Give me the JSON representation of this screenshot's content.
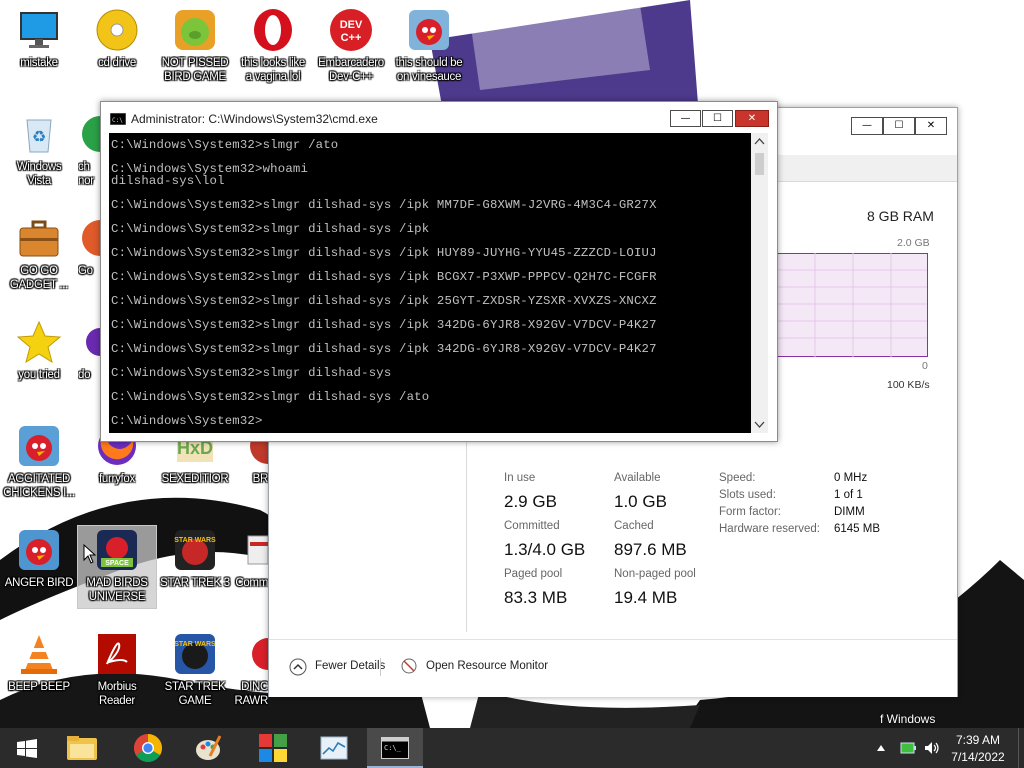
{
  "desktop": {
    "icons": [
      {
        "id": "mistake",
        "label": "mistake",
        "icon": "monitor-icon"
      },
      {
        "id": "cd-drive",
        "label": "cd drive",
        "icon": "cd-icon"
      },
      {
        "id": "not-pissed",
        "label": "NOT PISSED\nBIRD GAME",
        "icon": "green-pig-icon"
      },
      {
        "id": "opera",
        "label": "this looks like\na vagina lol",
        "icon": "opera-icon"
      },
      {
        "id": "devcpp",
        "label": "Embarcadero\nDev-C++",
        "icon": "devcpp-icon"
      },
      {
        "id": "vinesauce",
        "label": "this should be\non vinesauce",
        "icon": "angry-bird-icon"
      },
      {
        "id": "winvista",
        "label": "Windows\nVista",
        "icon": "recycle-bin-icon"
      },
      {
        "id": "go-gadget",
        "label": "GO GO\nGADGET ...",
        "icon": "briefcase-icon"
      },
      {
        "id": "you-tried",
        "label": "you tried",
        "icon": "star-icon"
      },
      {
        "id": "agitated",
        "label": "AGGITATED\nCHICKENS I...",
        "icon": "angry-bird-icon"
      },
      {
        "id": "furryfox",
        "label": "furryfox",
        "icon": "firefox-icon"
      },
      {
        "id": "sexeditor",
        "label": "SEXEDITIOR",
        "icon": "hex-editor-icon"
      },
      {
        "id": "anger-bird",
        "label": "ANGER BIRD",
        "icon": "angry-bird-icon"
      },
      {
        "id": "mad-birds",
        "label": "MAD BIRDS\nUNIVERSE",
        "icon": "angry-birds-space-icon"
      },
      {
        "id": "star-trek-3",
        "label": "STAR TREK 3",
        "icon": "star-wars-bird-icon"
      },
      {
        "id": "beep-beep",
        "label": "BEEP BEEP",
        "icon": "vlc-icon"
      },
      {
        "id": "morbius",
        "label": "Morbius\nReader",
        "icon": "pdf-icon"
      },
      {
        "id": "star-trek-game",
        "label": "STAR TREK\nGAME",
        "icon": "star-wars-bird-icon"
      }
    ],
    "partial_labels": {
      "col3_r2": "ch\nnor",
      "col3_r3": "Go",
      "col3_r4": "do",
      "col4_r5": "BR",
      "col4_r6": "Comm",
      "col4_r7": "DINC\nRAWR"
    },
    "watermark_fragment": "f Windows"
  },
  "cmd": {
    "title": "Administrator: C:\\Windows\\System32\\cmd.exe",
    "lines": [
      "C:\\Windows\\System32>slmgr /ato",
      "C:\\Windows\\System32>whoami",
      "dilshad-sys\\lol",
      "C:\\Windows\\System32>slmgr dilshad-sys /ipk MM7DF-G8XWM-J2VRG-4M3C4-GR27X",
      "C:\\Windows\\System32>slmgr dilshad-sys /ipk",
      "C:\\Windows\\System32>slmgr dilshad-sys /ipk HUY89-JUYHG-YYU45-ZZZCD-LOIUJ",
      "C:\\Windows\\System32>slmgr dilshad-sys /ipk BCGX7-P3XWP-PPPCV-Q2H7C-FCGFR",
      "C:\\Windows\\System32>slmgr dilshad-sys /ipk 25GYT-ZXDSR-YZSXR-XVXZS-XNCXZ",
      "C:\\Windows\\System32>slmgr dilshad-sys /ipk 342DG-6YJR8-X92GV-V7DCV-P4K27",
      "C:\\Windows\\System32>slmgr dilshad-sys /ipk 342DG-6YJR8-X92GV-V7DCV-P4K27",
      "C:\\Windows\\System32>slmgr dilshad-sys",
      "C:\\Windows\\System32>slmgr dilshad-sys /ato",
      "C:\\Windows\\System32>"
    ],
    "buttons": {
      "minimize": "—",
      "maximize": "☐",
      "close": "✕"
    }
  },
  "taskmgr": {
    "buttons": {
      "minimize": "—",
      "maximize": "☐",
      "close": "✕"
    },
    "ram_total": "8 GB RAM",
    "graph_max": "2.0 GB",
    "graph_min": "0",
    "speed_label": "100 KB/s",
    "stats": {
      "in_use_label": "In use",
      "in_use": "2.9 GB",
      "available_label": "Available",
      "available": "1.0 GB",
      "committed_label": "Committed",
      "committed": "1.3/4.0 GB",
      "cached_label": "Cached",
      "cached": "897.6 MB",
      "paged_label": "Paged pool",
      "paged": "83.3 MB",
      "nonpaged_label": "Non-paged pool",
      "nonpaged": "19.4 MB"
    },
    "details": [
      {
        "key": "Speed:",
        "value": "0 MHz"
      },
      {
        "key": "Slots used:",
        "value": "1 of 1"
      },
      {
        "key": "Form factor:",
        "value": "DIMM"
      },
      {
        "key": "Hardware reserved:",
        "value": "6145 MB"
      }
    ],
    "footer": {
      "fewer": "Fewer Details",
      "monitor": "Open Resource Monitor"
    }
  },
  "taskbar": {
    "items": [
      {
        "id": "start",
        "icon": "windows-start-icon"
      },
      {
        "id": "explorer",
        "icon": "folder-icon"
      },
      {
        "id": "chrome",
        "icon": "chrome-icon"
      },
      {
        "id": "paint",
        "icon": "paint-icon"
      },
      {
        "id": "winlogo",
        "icon": "windows-flag-icon"
      },
      {
        "id": "taskmgr",
        "icon": "task-manager-icon"
      },
      {
        "id": "cmd",
        "icon": "cmd-icon"
      }
    ],
    "time": "7:39 AM",
    "date": "7/14/2022"
  },
  "colors": {
    "taskbar": "#2b2b2b",
    "console_bg": "#000000",
    "console_fg": "#c0c0c0",
    "graph_line": "#8b2fa4",
    "graph_fill": "#f4e8f6"
  }
}
